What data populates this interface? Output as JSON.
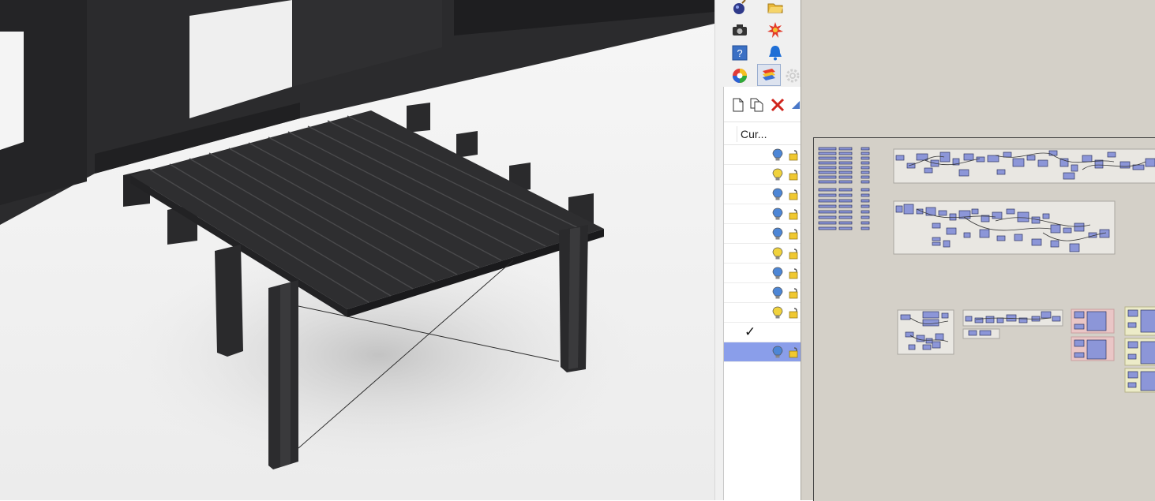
{
  "viewport": {
    "scene": "rendered-3d-model"
  },
  "toolstrip": {
    "buttons": [
      {
        "icon": "bomb-icon"
      },
      {
        "icon": "open-folder-icon"
      },
      {
        "icon": "camera-icon"
      },
      {
        "icon": "burst-icon"
      },
      {
        "icon": "help-icon"
      },
      {
        "icon": "bell-icon"
      },
      {
        "icon": "color-wheel-icon"
      },
      {
        "icon": "layers-panel-icon"
      },
      {
        "icon": "gear-icon"
      }
    ]
  },
  "layers_panel": {
    "toolbar": [
      {
        "icon": "new-layer-icon"
      },
      {
        "icon": "new-sublayer-icon"
      },
      {
        "icon": "delete-icon"
      },
      {
        "icon": "move-up-icon"
      }
    ],
    "column_header": "Cur...",
    "rows": [
      {
        "bulb": "on",
        "locked": false
      },
      {
        "bulb": "off",
        "locked": false
      },
      {
        "bulb": "on",
        "locked": false
      },
      {
        "bulb": "on",
        "locked": false
      },
      {
        "bulb": "on",
        "locked": false
      },
      {
        "bulb": "off",
        "locked": false
      },
      {
        "bulb": "on",
        "locked": false
      },
      {
        "bulb": "on",
        "locked": false
      },
      {
        "bulb": "off",
        "locked": false
      },
      {
        "current": "✓"
      },
      {
        "bulb": "on",
        "locked": false,
        "selected": true
      }
    ]
  },
  "grasshopper": {
    "canvas_background": "#d4d0c8",
    "component_color": "#8c96d8",
    "group_colors": [
      "#e9e7e2",
      "#eac6c6",
      "#ecebc8"
    ]
  },
  "colors": {
    "bulb_on": "#4d86d6",
    "bulb_off": "#f0d23c",
    "lock": "#f0c830",
    "selection": "#8a9eea"
  }
}
